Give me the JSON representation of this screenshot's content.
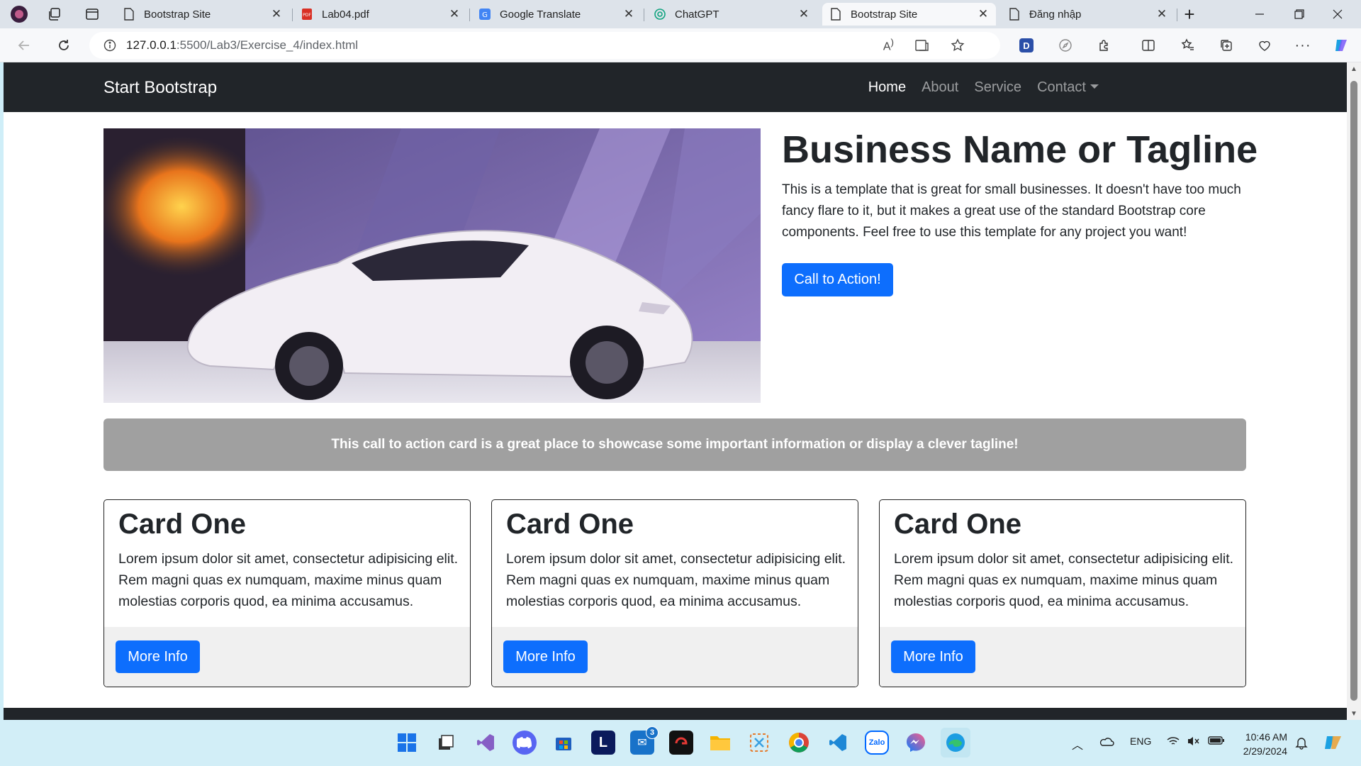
{
  "browser": {
    "tabs": [
      {
        "label": "Bootstrap Site",
        "icon": "page-icon",
        "active": false
      },
      {
        "label": "Lab04.pdf",
        "icon": "pdf-icon",
        "active": false
      },
      {
        "label": "Google Translate",
        "icon": "google-translate-icon",
        "active": false
      },
      {
        "label": "ChatGPT",
        "icon": "chatgpt-icon",
        "active": false
      },
      {
        "label": "Bootstrap Site",
        "icon": "page-icon",
        "active": true
      },
      {
        "label": "Đăng nhập",
        "icon": "page-icon",
        "active": false
      }
    ],
    "address": {
      "host": "127.0.0.1",
      "path": ":5500/Lab3/Exercise_4/index.html"
    }
  },
  "site": {
    "brand": "Start Bootstrap",
    "nav": {
      "home": "Home",
      "about": "About",
      "service": "Service",
      "contact": "Contact"
    },
    "hero": {
      "title": "Business Name or Tagline",
      "text": "This is a template that is great for small businesses. It doesn't have too much fancy flare to it, but it makes a great use of the standard Bootstrap core components. Feel free to use this template for any project you want!",
      "button": "Call to Action!"
    },
    "call_to_action": "This call to action card is a great place to showcase some important information or display a clever tagline!",
    "cards": [
      {
        "title": "Card One",
        "text": "Lorem ipsum dolor sit amet, consectetur adipisicing elit. Rem magni quas ex numquam, maxime minus quam molestias corporis quod, ea minima accusamus.",
        "button": "More Info"
      },
      {
        "title": "Card One",
        "text": "Lorem ipsum dolor sit amet, consectetur adipisicing elit. Rem magni quas ex numquam, maxime minus quam molestias corporis quod, ea minima accusamus.",
        "button": "More Info"
      },
      {
        "title": "Card One",
        "text": "Lorem ipsum dolor sit amet, consectetur adipisicing elit. Rem magni quas ex numquam, maxime minus quam molestias corporis quod, ea minima accusamus.",
        "button": "More Info"
      }
    ]
  },
  "taskbar": {
    "language": "ENG",
    "time": "10:46 AM",
    "date": "2/29/2024",
    "notification_count": "3"
  },
  "colors": {
    "primary": "#0d6efd",
    "navbar": "#212529",
    "cta_card": "#a0a0a0"
  }
}
